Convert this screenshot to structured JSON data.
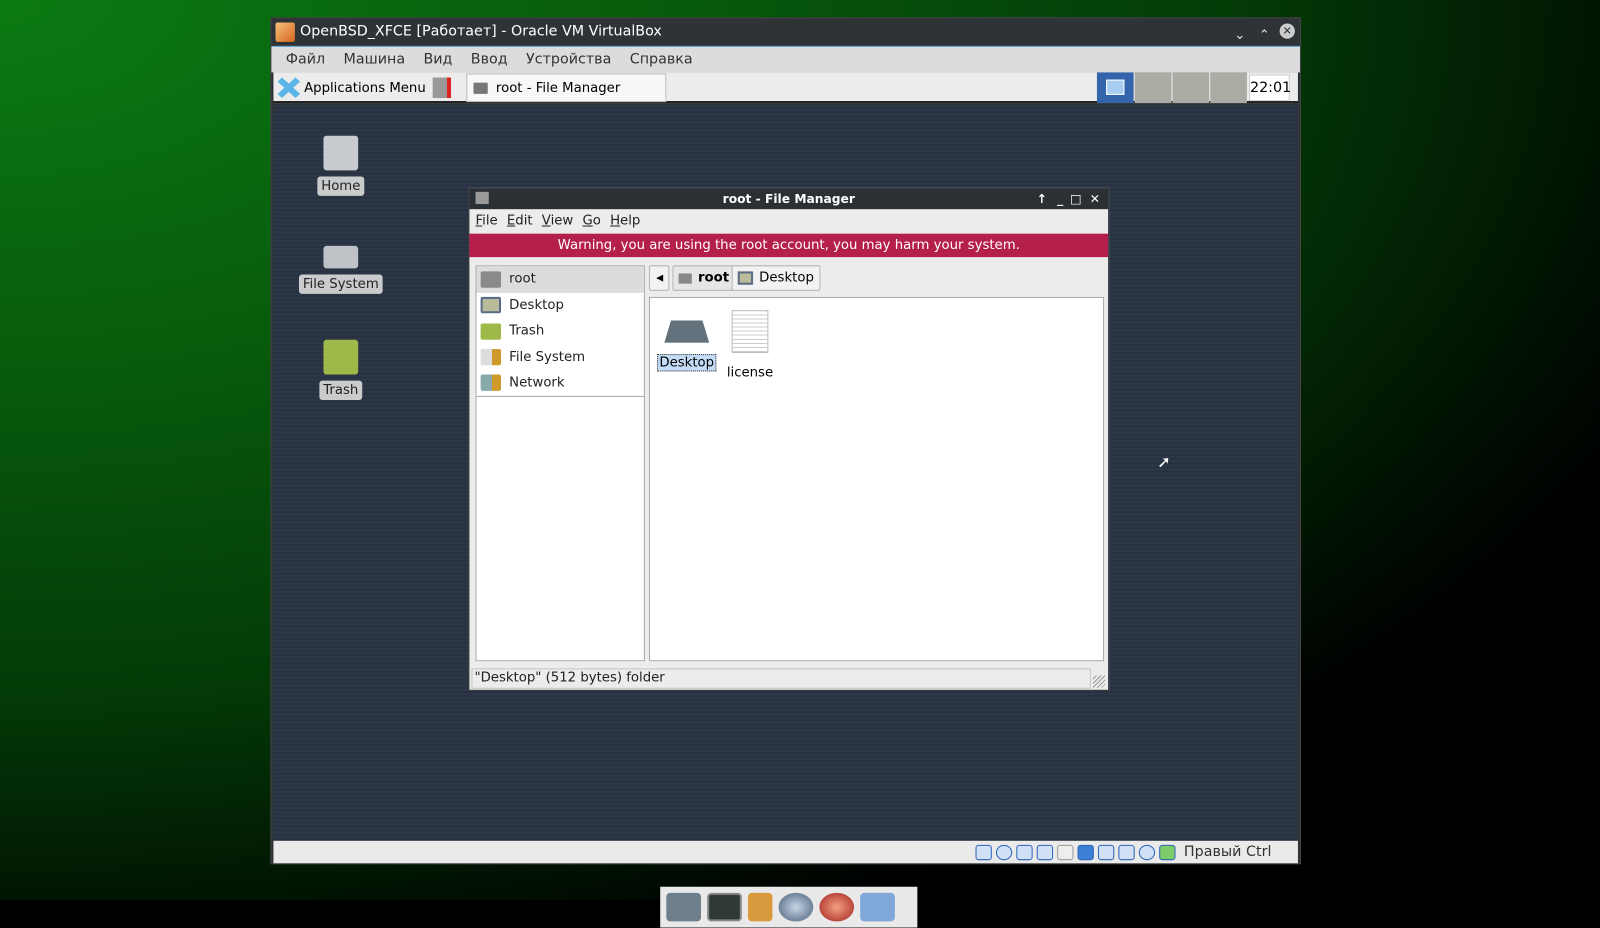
{
  "vm": {
    "title": "OpenBSD_XFCE [Работает] - Oracle VM VirtualBox",
    "menu": [
      "Файл",
      "Машина",
      "Вид",
      "Ввод",
      "Устройства",
      "Справка"
    ],
    "host_key": "Правый Ctrl"
  },
  "panel": {
    "apps_menu": "Applications Menu",
    "task": "root - File Manager",
    "clock": "22:01"
  },
  "desktop": {
    "icons": [
      "Home",
      "File System",
      "Trash"
    ]
  },
  "fm": {
    "title": "root - File Manager",
    "menu": [
      {
        "u": "F",
        "r": "ile"
      },
      {
        "u": "E",
        "r": "dit"
      },
      {
        "u": "V",
        "r": "iew"
      },
      {
        "u": "G",
        "r": "o"
      },
      {
        "u": "H",
        "r": "elp"
      }
    ],
    "warning": "Warning, you are using the root account, you may harm your system.",
    "sidebar": [
      "root",
      "Desktop",
      "Trash",
      "File System",
      "Network"
    ],
    "path": [
      "root",
      "Desktop"
    ],
    "files": [
      "Desktop",
      "license"
    ],
    "status": "\"Desktop\" (512 bytes) folder"
  }
}
